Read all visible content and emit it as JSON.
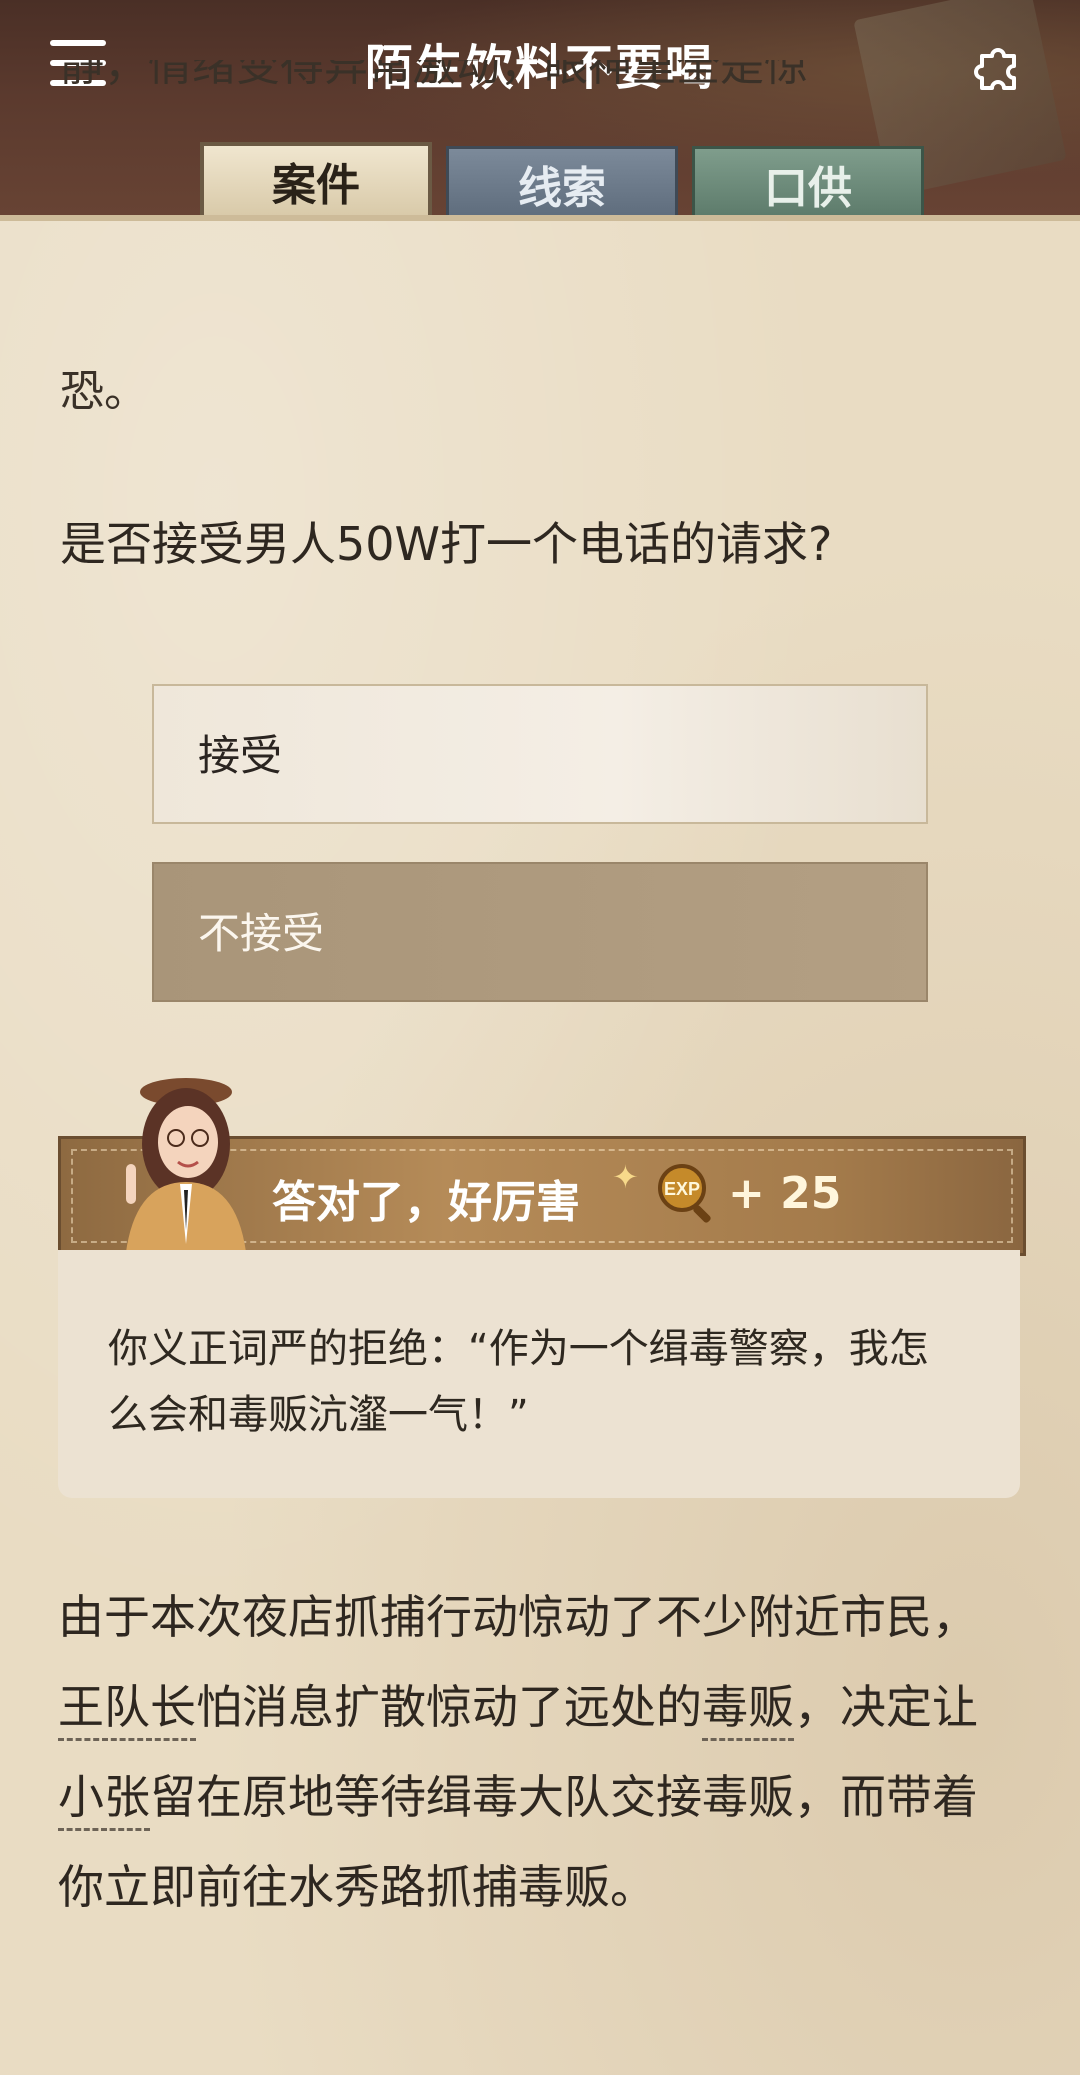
{
  "header": {
    "title": "陌生饮料不要喝",
    "menu_icon": "hamburger-menu-icon",
    "puzzle_icon": "puzzle-piece-icon"
  },
  "tabs": [
    {
      "label": "案件",
      "active": true
    },
    {
      "label": "线索",
      "active": false
    },
    {
      "label": "口供",
      "active": false
    }
  ],
  "story": {
    "clipped_line": "静，情绪变得异常激动，眼神里全是惊",
    "fear_line": "恐。",
    "question": "是否接受男人50W打一个电话的请求?"
  },
  "choices": [
    {
      "label": "接受",
      "selected": false
    },
    {
      "label": "不接受",
      "selected": true
    }
  ],
  "result": {
    "banner_text": "答对了，好厉害",
    "exp_label": "EXP",
    "exp_value": "+ 25",
    "text": "你义正词严的拒绝：“作为一个缉毒警察，我怎么会和毒贩沆瀣一气！”"
  },
  "continuation": {
    "p1": "由于本次夜店抓捕行动惊动了不少附近市民，",
    "link1": "王队长",
    "p2": "怕消息扩散惊动了远处的",
    "link2": "毒贩",
    "p3": "，决定让",
    "link3": "小张",
    "p4": "留在原地等待缉毒大队交接毒贩，而带着你立即前往水秀路抓捕毒贩。"
  },
  "colors": {
    "paper": "#e9dcc3",
    "banner": "#b58b58",
    "tab_clue": "#6c7a8a",
    "tab_testimony": "#6f8d7c"
  }
}
